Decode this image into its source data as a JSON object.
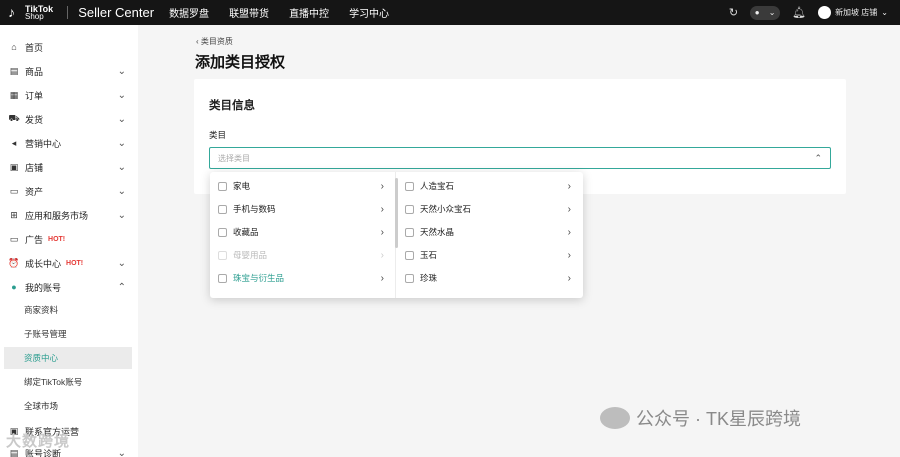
{
  "brand": {
    "name_line1": "TikTok",
    "name_line2": "Shop",
    "title": "Seller Center"
  },
  "top_nav": [
    "数据罗盘",
    "联盟带货",
    "直播中控",
    "学习中心"
  ],
  "top_right": {
    "store_name": "新加坡 店铺"
  },
  "sidebar": {
    "items": [
      {
        "label": "首页",
        "icon": "home-icon",
        "glyph": "⌂",
        "chevron": ""
      },
      {
        "label": "商品",
        "icon": "product-icon",
        "glyph": "▤",
        "chevron": "⌄"
      },
      {
        "label": "订单",
        "icon": "order-icon",
        "glyph": "▦",
        "chevron": "⌄"
      },
      {
        "label": "发货",
        "icon": "truck-icon",
        "glyph": "⛟",
        "chevron": "⌄"
      },
      {
        "label": "营销中心",
        "icon": "megaphone-icon",
        "glyph": "◂",
        "chevron": "⌄"
      },
      {
        "label": "店铺",
        "icon": "store-icon",
        "glyph": "▣",
        "chevron": "⌄"
      },
      {
        "label": "资产",
        "icon": "wallet-icon",
        "glyph": "▭",
        "chevron": "⌄"
      },
      {
        "label": "应用和服务市场",
        "icon": "apps-icon",
        "glyph": "⊞",
        "chevron": "⌄"
      },
      {
        "label": "广告",
        "icon": "ads-icon",
        "glyph": "▭",
        "chevron": "",
        "badge": "HOT!"
      },
      {
        "label": "成长中心",
        "icon": "growth-icon",
        "glyph": "⏰",
        "chevron": "⌄",
        "badge": "HOT!"
      },
      {
        "label": "我的账号",
        "icon": "account-icon",
        "glyph": "●",
        "chevron": "⌃"
      }
    ],
    "sub_items": [
      {
        "label": "商家资料",
        "active": false
      },
      {
        "label": "子账号管理",
        "active": false
      },
      {
        "label": "资质中心",
        "active": true
      },
      {
        "label": "绑定TikTok账号",
        "active": false
      },
      {
        "label": "全球市场",
        "active": false
      }
    ],
    "bottom_items": [
      {
        "label": "联系官方运营",
        "icon": "contact-icon",
        "glyph": "▣"
      },
      {
        "label": "账号诊断",
        "icon": "diagnose-icon",
        "glyph": "▤",
        "chevron": "⌄"
      }
    ]
  },
  "main": {
    "breadcrumb": "类目资质",
    "page_title": "添加类目授权",
    "card_title": "类目信息",
    "field_label": "类目",
    "select_placeholder": "选择类目"
  },
  "dropdown": {
    "left": [
      {
        "label": "家电",
        "state": "normal"
      },
      {
        "label": "手机与数码",
        "state": "normal"
      },
      {
        "label": "收藏品",
        "state": "normal"
      },
      {
        "label": "母婴用品",
        "state": "disabled"
      },
      {
        "label": "珠宝与衍生品",
        "state": "selected"
      }
    ],
    "right": [
      {
        "label": "人造宝石"
      },
      {
        "label": "天然小众宝石"
      },
      {
        "label": "天然水晶"
      },
      {
        "label": "玉石"
      },
      {
        "label": "珍珠"
      }
    ]
  },
  "watermarks": {
    "right": "公众号 · TK星辰跨境",
    "left": "大数跨境"
  },
  "colors": {
    "accent": "#2a9d8f",
    "topbar": "#151515",
    "hot": "#e53935"
  }
}
